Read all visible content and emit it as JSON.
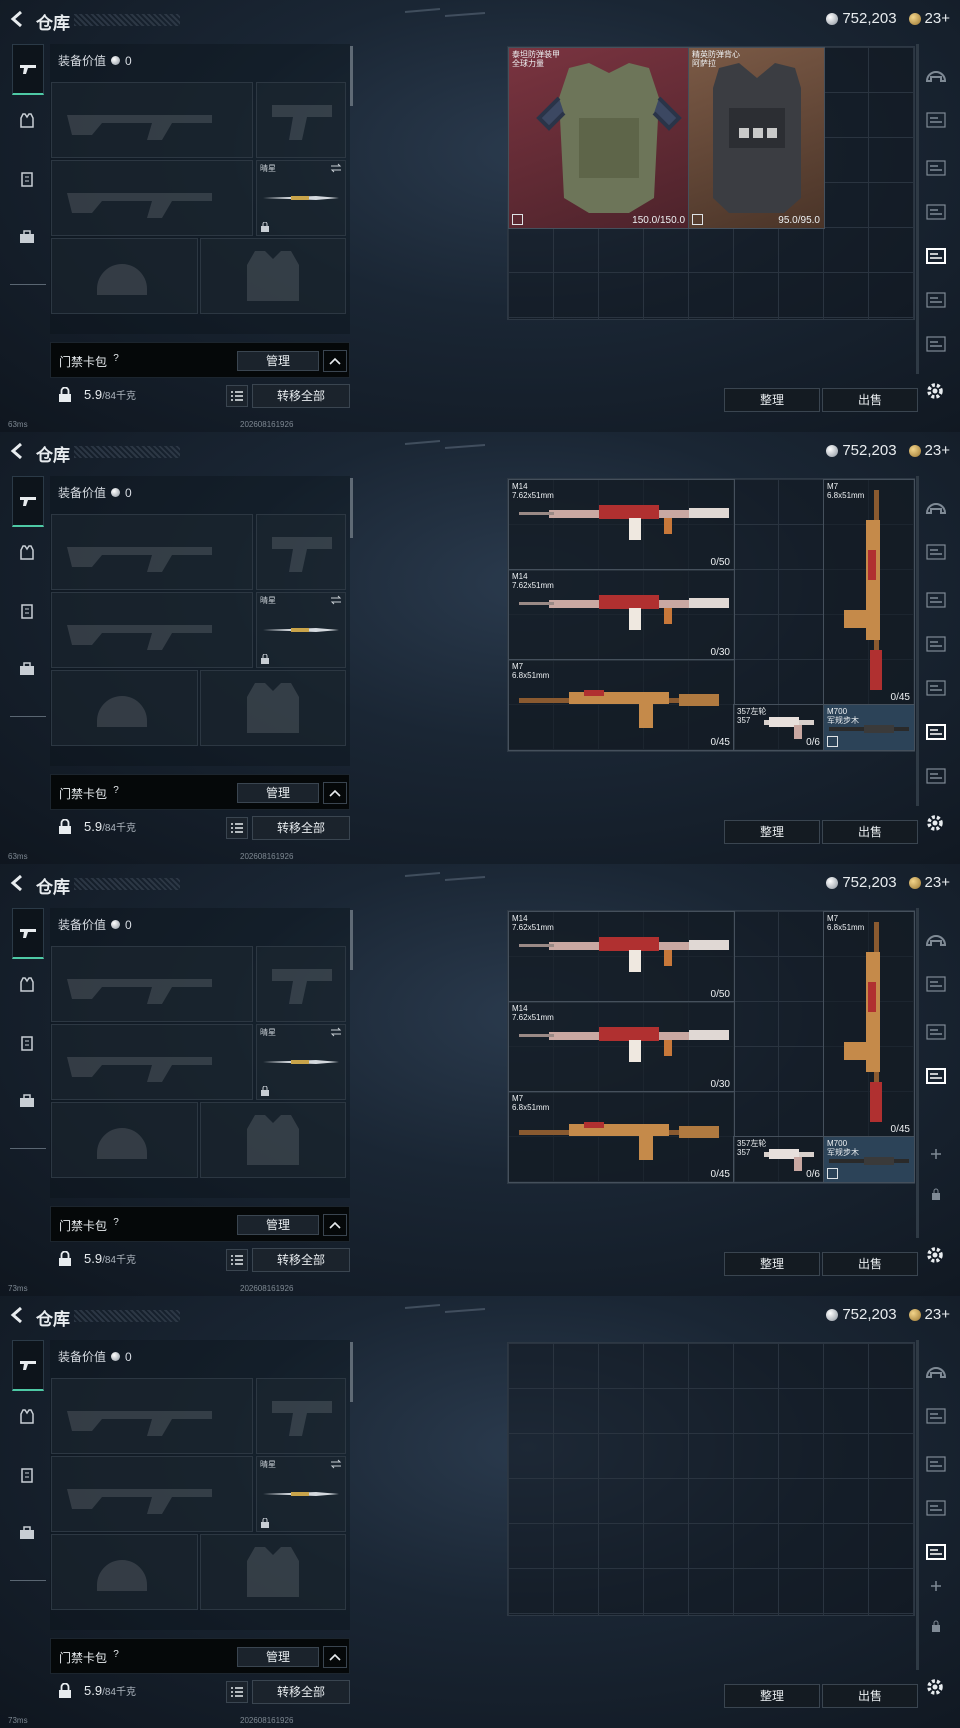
{
  "header": {
    "title": "仓库",
    "silver": "752,203",
    "gold": "23+"
  },
  "loadout": {
    "equip_value_label": "装备价值",
    "equip_value": "0",
    "melee_label": "晴星",
    "keycard_label": "门禁卡包",
    "help": "?",
    "manage": "管理",
    "weight_value": "5.9",
    "weight_unit": "/84千克",
    "transfer_all": "转移全部"
  },
  "actions": {
    "sort": "整理",
    "sell": "出售"
  },
  "screens": [
    {
      "status": "63ms",
      "date": "202608161926",
      "items": [
        {
          "name": "泰坦防弹装甲\n全球力量",
          "stat": "150.0/150.0",
          "kind": "armor-green"
        },
        {
          "name": "精英防弹背心\n阿萨拉",
          "stat": "95.0/95.0",
          "kind": "armor-black"
        }
      ]
    },
    {
      "status": "63ms",
      "date": "202608161926",
      "items": [
        {
          "name": "M14\n7.62x51mm",
          "stat": "0/50"
        },
        {
          "name": "M14\n7.62x51mm",
          "stat": "0/30"
        },
        {
          "name": "M7\n6.8x51mm",
          "stat": "0/45"
        },
        {
          "name": "357左轮\n357",
          "stat": "0/6"
        },
        {
          "name": "M7\n6.8x51mm",
          "stat": "0/45"
        },
        {
          "name": "M700\n军规步木",
          "stat": ""
        }
      ]
    },
    {
      "status": "73ms",
      "date": "202608161926",
      "items": [
        {
          "name": "M14\n7.62x51mm",
          "stat": "0/50"
        },
        {
          "name": "M14\n7.62x51mm",
          "stat": "0/30"
        },
        {
          "name": "M7\n6.8x51mm",
          "stat": "0/45"
        },
        {
          "name": "357左轮\n357",
          "stat": "0/6"
        },
        {
          "name": "M7\n6.8x51mm",
          "stat": "0/45"
        },
        {
          "name": "M700\n军规步木",
          "stat": ""
        }
      ]
    },
    {
      "status": "73ms",
      "date": "202608161926",
      "items": []
    }
  ],
  "colors": {
    "accent": "#4ec9a5",
    "armor_bg_red": "#6a2e38",
    "armor_bg_brown": "#6b4e3e",
    "selected_bg": "#2c4358"
  },
  "icons": {
    "back": "back-arrow-icon",
    "silver": "silver-coin-icon",
    "gold": "gold-coin-icon",
    "gear": "gear-icon",
    "lock": "lock-icon",
    "list": "list-icon",
    "swap": "swap-icon",
    "chevron": "chevron-up-icon"
  }
}
